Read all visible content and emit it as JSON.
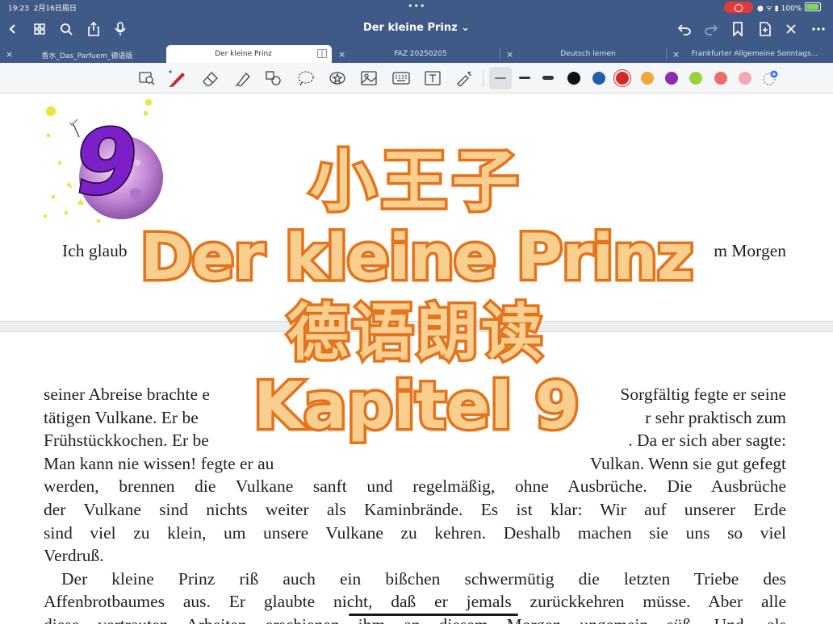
{
  "status_bar": {
    "time": "19:23",
    "date": "2月16日周日",
    "battery": "100%"
  },
  "nav": {
    "title": "Der kleine Prinz ⌄"
  },
  "tabs": [
    {
      "label": "香水_Das_Parfuem_德语版",
      "active": false
    },
    {
      "label": "Der kleine Prinz",
      "active": true
    },
    {
      "label": "FAZ 20250205",
      "active": false
    },
    {
      "label": "Deutsch lernen",
      "active": false
    },
    {
      "label": "Frankfurter Allgemeine Sonntags...",
      "active": false
    }
  ],
  "toolbar": {
    "tools": [
      "image-zoom-icon",
      "pen-icon",
      "eraser-icon",
      "highlighter-icon",
      "shapes-icon",
      "lasso-icon",
      "sticker-icon",
      "image-icon",
      "keyboard-icon",
      "text-box-icon",
      "laser-pointer-icon"
    ],
    "colors": [
      "#111111",
      "#1f5fa8",
      "#d62728",
      "#f4a43a",
      "#8e2cb0",
      "#9bd23a",
      "#f06b6b",
      "#f4a8b2"
    ],
    "selected_color": "#d62728"
  },
  "page1": {
    "chapter_number": "9",
    "line_left": "Ich glaub",
    "line_right": "m Morgen"
  },
  "page2": {
    "lines": [
      "seiner Abreise brachte e",
      "Sorgfältig fegte er seine",
      "tätigen Vulkane. Er be",
      "r sehr praktisch zum",
      "Frühstückkochen. Er be",
      ". Da er sich aber sagte:",
      "Man kann nie wissen! fegte er au",
      "Vulkan. Wenn sie gut gefegt",
      "werden, brennen die Vulkane sanft und regelmäßig, ohne Ausbrüche. Die Ausbrüche",
      "der Vulkane sind nichts weiter als Kaminbrände. Es ist klar: Wir auf unserer Erde",
      "sind viel zu klein, um unsere Vulkane zu kehren. Deshalb machen sie uns so viel",
      "Verdruß.",
      "Der kleine Prinz riß auch ein bißchen schwermütig die letzten Triebe des",
      "Affenbrotbaumes aus. Er glaubte nicht, daß er jemals zurückkehren müsse. Aber alle",
      "diese vertrauten Arbeiten erschienen ihm an diesem Morgen ungemein süß. Und, als"
    ]
  },
  "overlay": {
    "line1": "小王子",
    "line2": "Der kleine Prinz",
    "line3": "德语朗读",
    "line4": "Kapitel 9"
  }
}
